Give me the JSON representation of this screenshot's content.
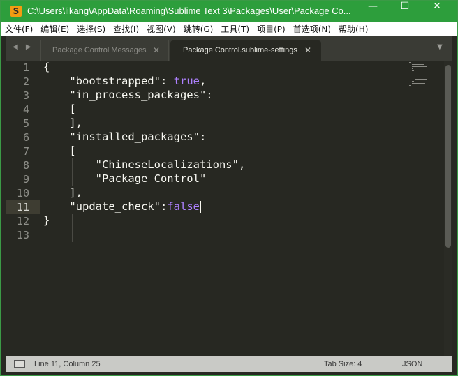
{
  "window": {
    "title": "C:\\Users\\likang\\AppData\\Roaming\\Sublime Text 3\\Packages\\User\\Package Co...",
    "app_icon_letter": "S",
    "minimize_glyph": "—",
    "maximize_glyph": "☐",
    "close_glyph": "✕",
    "accent_color": "#2d9e3c"
  },
  "menu": [
    "文件(F)",
    "编辑(E)",
    "选择(S)",
    "查找(I)",
    "视图(V)",
    "跳转(G)",
    "工具(T)",
    "项目(P)",
    "首选项(N)",
    "帮助(H)"
  ],
  "tabs": {
    "nav_arrows": "◀ ▶",
    "items": [
      {
        "label": "Package Control Messages",
        "close": "✕",
        "active": false
      },
      {
        "label": "Package Control.sublime-settings",
        "close": "✕",
        "active": true
      }
    ],
    "dropdown_glyph": "▼"
  },
  "editor": {
    "line_numbers": [
      "1",
      "2",
      "3",
      "4",
      "5",
      "6",
      "7",
      "8",
      "9",
      "10",
      "11",
      "12",
      "13"
    ],
    "active_line": 11,
    "lines": [
      [
        {
          "t": "{",
          "c": "pun"
        }
      ],
      [
        {
          "t": "    ",
          "c": "pun"
        },
        {
          "t": "\"bootstrapped\"",
          "c": "str"
        },
        {
          "t": ": ",
          "c": "pun"
        },
        {
          "t": "true",
          "c": "kw"
        },
        {
          "t": ",",
          "c": "pun"
        }
      ],
      [
        {
          "t": "    ",
          "c": "pun"
        },
        {
          "t": "\"in_process_packages\"",
          "c": "str"
        },
        {
          "t": ":",
          "c": "pun"
        }
      ],
      [
        {
          "t": "    [",
          "c": "pun"
        }
      ],
      [
        {
          "t": "    ],",
          "c": "pun"
        }
      ],
      [
        {
          "t": "    ",
          "c": "pun"
        },
        {
          "t": "\"installed_packages\"",
          "c": "str"
        },
        {
          "t": ":",
          "c": "pun"
        }
      ],
      [
        {
          "t": "    [",
          "c": "pun"
        }
      ],
      [
        {
          "t": "        ",
          "c": "pun"
        },
        {
          "t": "\"ChineseLocalizations\"",
          "c": "str"
        },
        {
          "t": ",",
          "c": "pun"
        }
      ],
      [
        {
          "t": "        ",
          "c": "pun"
        },
        {
          "t": "\"Package Control\"",
          "c": "str"
        }
      ],
      [
        {
          "t": "    ],",
          "c": "pun"
        }
      ],
      [
        {
          "t": "    ",
          "c": "pun"
        },
        {
          "t": "\"update_check\"",
          "c": "str"
        },
        {
          "t": ":",
          "c": "pun"
        },
        {
          "t": "false",
          "c": "kw"
        }
      ],
      [
        {
          "t": "}",
          "c": "pun"
        }
      ],
      [
        {
          "t": "",
          "c": "pun"
        }
      ]
    ],
    "colors": {
      "background": "#272822",
      "keyword": "#ae81ff",
      "text": "#f8f8f2",
      "gutter": "#8f908a"
    }
  },
  "status": {
    "position": "Line 11, Column 25",
    "tab_size": "Tab Size: 4",
    "syntax": "JSON"
  }
}
